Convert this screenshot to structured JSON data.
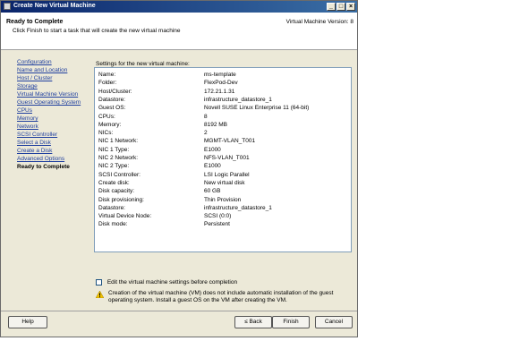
{
  "window": {
    "title": "Create New Virtual Machine",
    "minimize_glyph": "_",
    "maximize_glyph": "□",
    "close_glyph": "×"
  },
  "header": {
    "title": "Ready to Complete",
    "subtitle": "Click Finish to start a task that will create the new virtual machine",
    "version": "Virtual Machine Version: 8"
  },
  "steps": [
    {
      "label": "Configuration",
      "current": false
    },
    {
      "label": "Name and Location",
      "current": false
    },
    {
      "label": "Host / Cluster",
      "current": false
    },
    {
      "label": "Storage",
      "current": false
    },
    {
      "label": "Virtual Machine Version",
      "current": false
    },
    {
      "label": "Guest Operating System",
      "current": false
    },
    {
      "label": "CPUs",
      "current": false
    },
    {
      "label": "Memory",
      "current": false
    },
    {
      "label": "Network",
      "current": false
    },
    {
      "label": "SCSI Controller",
      "current": false
    },
    {
      "label": "Select a Disk",
      "current": false
    },
    {
      "label": "Create a Disk",
      "current": false
    },
    {
      "label": "Advanced Options",
      "current": false
    },
    {
      "label": "Ready to Complete",
      "current": true
    }
  ],
  "settings": {
    "caption": "Settings for the new virtual machine:",
    "rows": [
      {
        "key": "Name:",
        "value": "ms-template"
      },
      {
        "key": "Folder:",
        "value": "FlexPod-Dev"
      },
      {
        "key": "Host/Cluster:",
        "value": "172.21.1.31"
      },
      {
        "key": "Datastore:",
        "value": "infrastructure_datastore_1"
      },
      {
        "key": "Guest OS:",
        "value": "Novell SUSE Linux Enterprise 11 (64-bit)"
      },
      {
        "key": "CPUs:",
        "value": "8"
      },
      {
        "key": "Memory:",
        "value": "8192 MB"
      },
      {
        "key": "NICs:",
        "value": "2"
      },
      {
        "key": "NIC 1 Network:",
        "value": "MGMT-VLAN_T001"
      },
      {
        "key": "NIC 1 Type:",
        "value": "E1000"
      },
      {
        "key": "NIC 2 Network:",
        "value": "NFS-VLAN_T001"
      },
      {
        "key": "NIC 2 Type:",
        "value": "E1000"
      },
      {
        "key": "SCSI Controller:",
        "value": "LSI Logic Parallel"
      },
      {
        "key": "Create disk:",
        "value": "New virtual disk"
      },
      {
        "key": "Disk capacity:",
        "value": "60 GB"
      },
      {
        "key": "Disk provisioning:",
        "value": "Thin Provision"
      },
      {
        "key": "Datastore:",
        "value": "infrastructure_datastore_1"
      },
      {
        "key": "Virtual Device Node:",
        "value": "SCSI (0:0)"
      },
      {
        "key": "Disk mode:",
        "value": "Persistent"
      }
    ]
  },
  "edit_checkbox": {
    "label": "Edit the virtual machine settings before completion",
    "checked": false
  },
  "warning": {
    "text": "Creation of the virtual machine (VM) does not include automatic installation of the guest operating system. Install a guest OS on the VM after creating the VM."
  },
  "buttons": {
    "help": "Help",
    "back": "≤ Back",
    "finish": "Finish",
    "cancel": "Cancel"
  },
  "colors": {
    "titlebar": "#0a246a",
    "link": "#1f3f9f",
    "warning": "#f2c200"
  }
}
